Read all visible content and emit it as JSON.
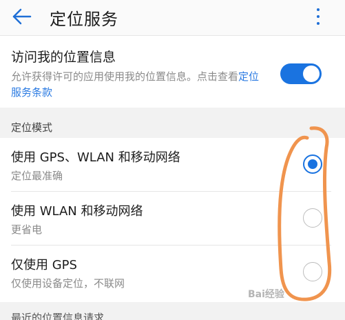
{
  "header": {
    "title": "定位服务"
  },
  "access": {
    "title": "访问我的位置信息",
    "desc_prefix": "允许获得许可的应用使用我的位置信息。点击查看",
    "desc_link": "定位服务条款",
    "enabled": true
  },
  "section": {
    "label": "定位模式"
  },
  "modes": [
    {
      "title": "使用 GPS、WLAN 和移动网络",
      "subtitle": "定位最准确",
      "selected": true
    },
    {
      "title": "使用 WLAN 和移动网络",
      "subtitle": "更省电",
      "selected": false
    },
    {
      "title": "仅使用 GPS",
      "subtitle": "仅使用设备定位，不联网",
      "selected": false
    }
  ],
  "bottom_section": {
    "label": "最近的位置信息请求"
  },
  "watermark": "Bai经验",
  "colors": {
    "accent": "#1a73e0",
    "link": "#2a7ae2",
    "annotation": "#f0944e"
  }
}
